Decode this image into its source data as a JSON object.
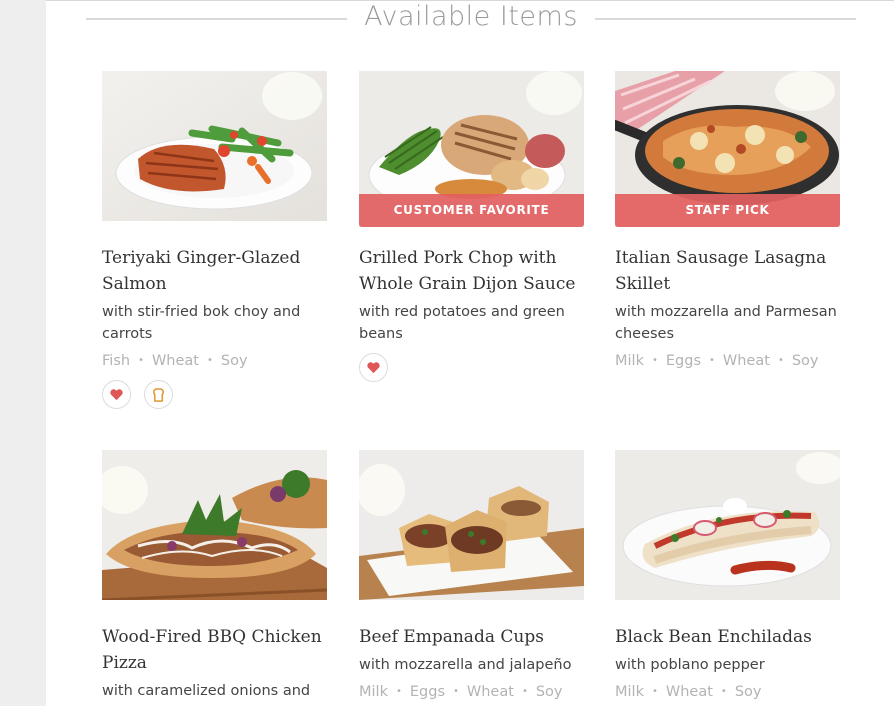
{
  "section": {
    "title": "Available Items"
  },
  "items": [
    {
      "name": "Teriyaki Ginger-Glazed Salmon",
      "description": "with stir-fried bok choy and carrots",
      "allergens": [
        "Fish",
        "Wheat",
        "Soy"
      ],
      "badge": "",
      "icons": [
        "heart-icon",
        "bread-icon"
      ]
    },
    {
      "name": "Grilled Pork Chop with Whole Grain Dijon Sauce",
      "description": "with red potatoes and green beans",
      "allergens": [],
      "badge": "CUSTOMER FAVORITE",
      "icons": [
        "heart-icon"
      ]
    },
    {
      "name": "Italian Sausage Lasagna Skillet",
      "description": "with mozzarella and Parmesan cheeses",
      "allergens": [
        "Milk",
        "Eggs",
        "Wheat",
        "Soy"
      ],
      "badge": "STAFF PICK",
      "icons": []
    },
    {
      "name": "Wood-Fired BBQ Chicken Pizza",
      "description": "with caramelized onions and",
      "allergens": [],
      "badge": "",
      "icons": []
    },
    {
      "name": "Beef Empanada Cups",
      "description": "with mozzarella and jalapeño",
      "allergens": [
        "Milk",
        "Eggs",
        "Wheat",
        "Soy"
      ],
      "badge": "",
      "icons": []
    },
    {
      "name": "Black Bean Enchiladas",
      "description": "with poblano pepper",
      "allergens": [
        "Milk",
        "Wheat",
        "Soy"
      ],
      "badge": "",
      "icons": []
    }
  ],
  "colors": {
    "badge": "#e26060",
    "heart": "#e05555",
    "bread": "#e0a040"
  }
}
